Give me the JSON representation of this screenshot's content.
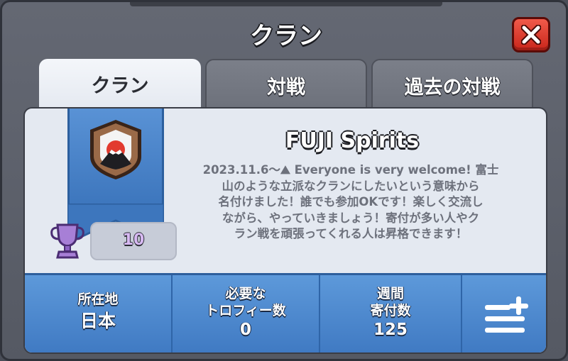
{
  "window": {
    "title": "クラン",
    "close_icon": "close-x-icon"
  },
  "tabs": [
    {
      "label": "クラン",
      "active": true
    },
    {
      "label": "対戦",
      "active": false
    },
    {
      "label": "過去の対戦",
      "active": false
    }
  ],
  "clan": {
    "name": "FUJI Spirits",
    "badge_icon": "mount-fuji-shield-badge-icon",
    "trophies": "10",
    "description": "2023.11.6～⛰ Everyone is very welcome! 富士\n山のような立派なクランにしたいという意味から\n名付けました！誰でも参加OKです！楽しく交流し\nながら、やっていきましょう！寄付が多い人やク\nラン戦を頑張ってくれる人は昇格できます！"
  },
  "stats": {
    "location_label": "所在地",
    "location_value": "日本",
    "required_trophies_label": "必要な\nトロフィー数",
    "required_trophies_value": "0",
    "weekly_donations_label": "週間\n寄付数",
    "weekly_donations_value": "125",
    "menu_icon": "list-plus-icon"
  },
  "colors": {
    "accent_blue": "#4a86cc",
    "close_red": "#d9352a",
    "card_bg": "#e4e9f1",
    "trophy_purple": "#a77fd6"
  }
}
